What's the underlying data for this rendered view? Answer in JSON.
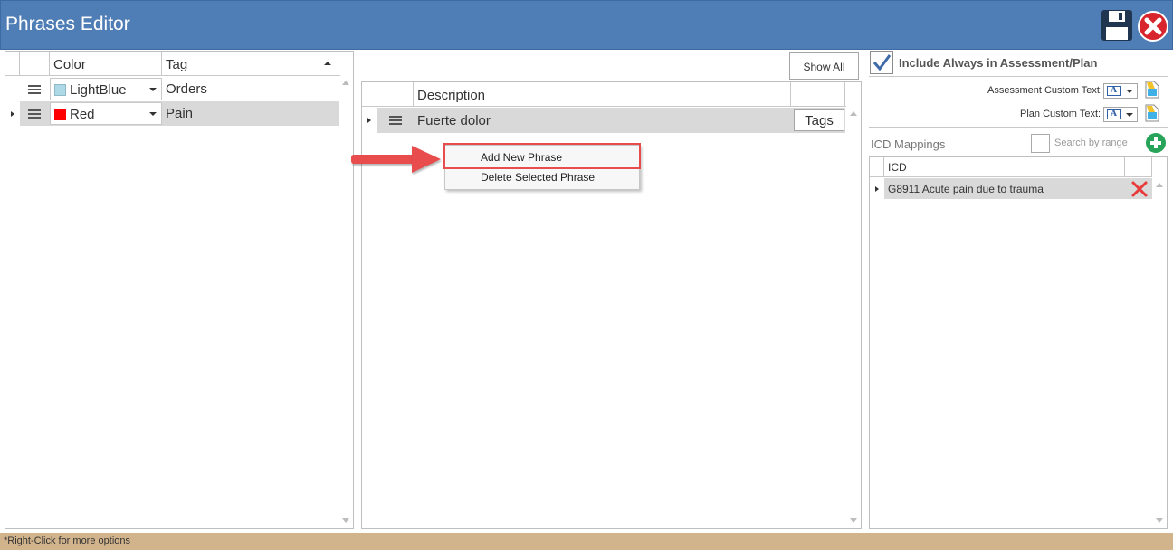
{
  "window": {
    "title": "Phrases Editor",
    "save_icon": "floppy-disk-icon",
    "close_icon": "close-circle-icon"
  },
  "tags_grid": {
    "columns": [
      "Color",
      "Tag"
    ],
    "rows": [
      {
        "color_name": "LightBlue",
        "color_hex": "#add8e6",
        "tag": "Orders",
        "selected": false
      },
      {
        "color_name": "Red",
        "color_hex": "#ff0000",
        "tag": "Pain",
        "selected": true
      }
    ]
  },
  "phrases": {
    "show_all_label": "Show All",
    "column_description": "Description",
    "rows": [
      {
        "description": "Fuerte dolor",
        "tags_button": "Tags"
      }
    ],
    "context_menu": {
      "items": [
        "Add New Phrase",
        "Delete Selected Phrase"
      ],
      "highlighted": "Add New Phrase"
    }
  },
  "right_panel": {
    "include_always_label": "Include Always in Assessment/Plan",
    "include_always_checked": true,
    "assessment_custom_text_label": "Assessment Custom Text:",
    "plan_custom_text_label": "Plan Custom Text:",
    "icd_mappings_label": "ICD Mappings",
    "search_by_range_label": "Search by range",
    "icd_column": "ICD",
    "icd_rows": [
      {
        "text": "G8911 Acute pain due to trauma"
      }
    ]
  },
  "status": {
    "hint": "*Right-Click for more options"
  },
  "colors": {
    "titlebar": "#4f7db5",
    "statusbar": "#d2b48c",
    "highlight": "#e84c4c",
    "add_green": "#27a35a"
  }
}
